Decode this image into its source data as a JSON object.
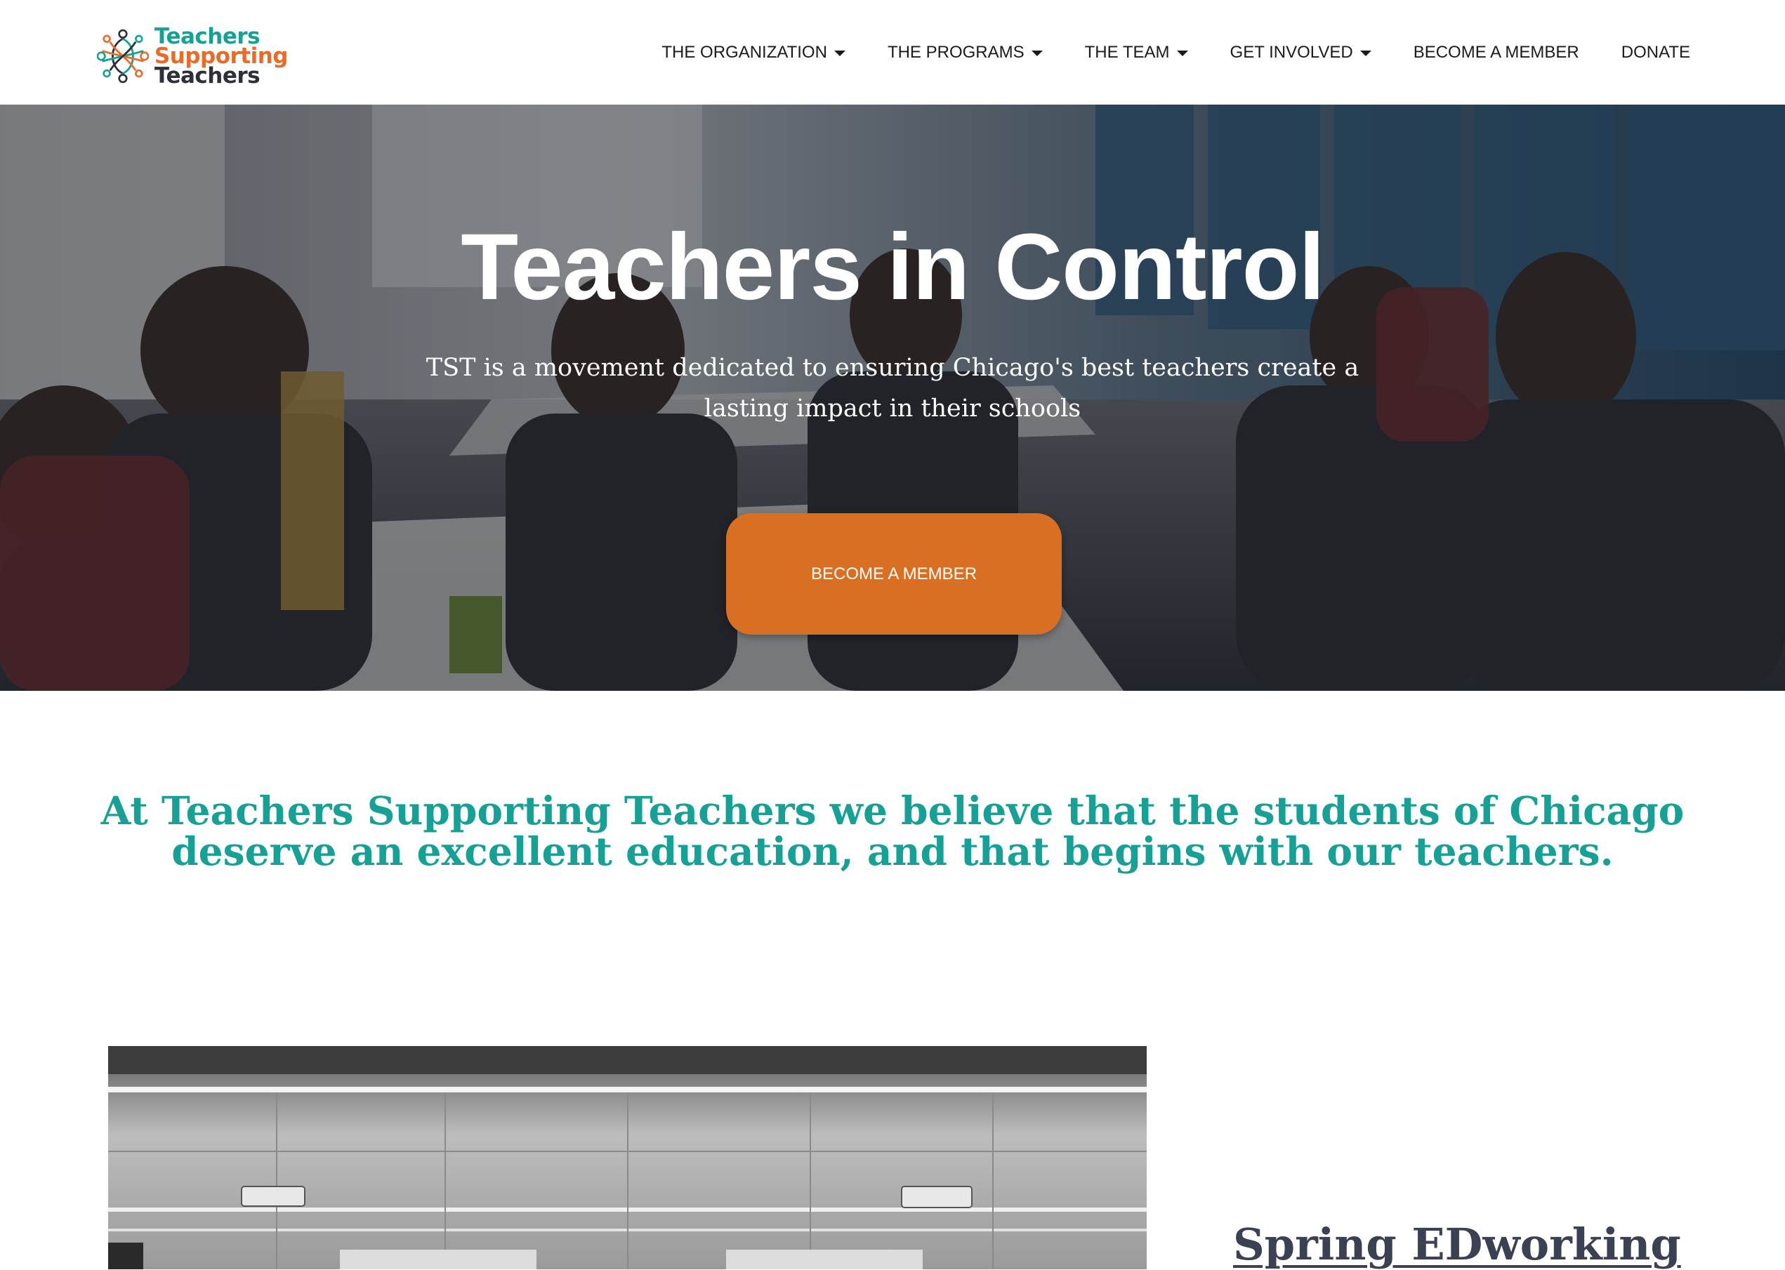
{
  "brand": {
    "line1": "Teachers",
    "line2": "Supporting",
    "line3": "Teachers",
    "colors": {
      "teal": "#17a096",
      "orange": "#e66c2c",
      "dark": "#2d2f3a"
    },
    "icon": "network-people-logo-icon"
  },
  "nav": {
    "items": [
      {
        "label": "THE ORGANIZATION",
        "dropdown": true
      },
      {
        "label": "THE PROGRAMS",
        "dropdown": true
      },
      {
        "label": "THE TEAM",
        "dropdown": true
      },
      {
        "label": "GET INVOLVED",
        "dropdown": true
      },
      {
        "label": "BECOME A MEMBER",
        "dropdown": false
      },
      {
        "label": "DONATE",
        "dropdown": false
      }
    ]
  },
  "hero": {
    "title": "Teachers in Control",
    "subtitle": "TST is a movement dedicated to ensuring Chicago's best teachers create a lasting impact in their schools",
    "button_label": "BECOME A MEMBER",
    "button_color": "#d96f22"
  },
  "mission": {
    "text": "At Teachers Supporting Teachers we believe that the students of Chicago deserve an excellent education, and that begins with our teachers.",
    "color": "#17a096"
  },
  "event": {
    "title": "Spring EDworking",
    "title_color": "#3b4152"
  }
}
